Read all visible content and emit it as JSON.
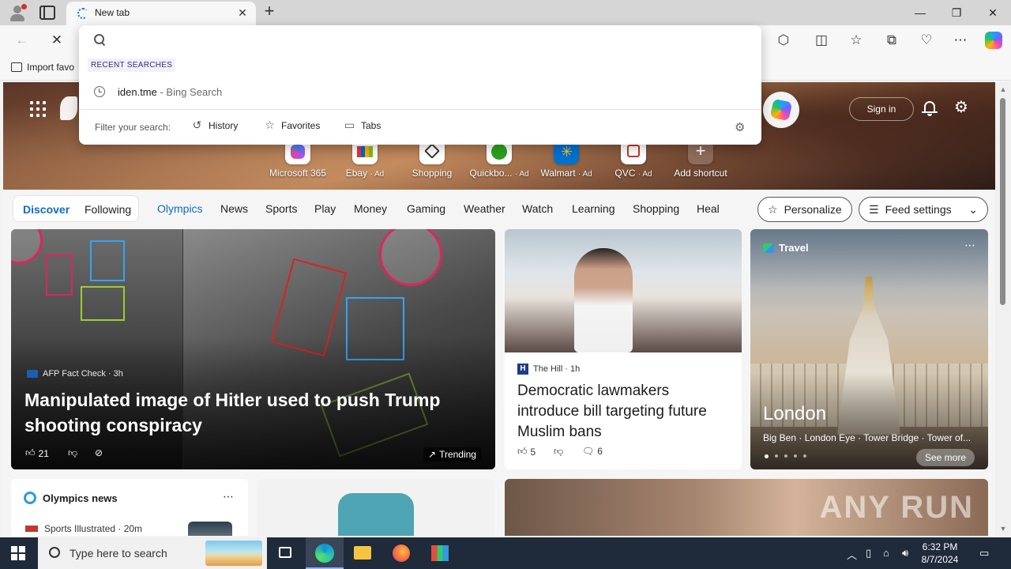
{
  "browser": {
    "tab_title": "New tab",
    "favorites_bar": {
      "import_label": "Import favo"
    }
  },
  "omnibox": {
    "placeholder": "",
    "recent_header": "RECENT SEARCHES",
    "recent": [
      {
        "query": "iden.tme",
        "suffix": " - Bing Search"
      }
    ],
    "filter_label": "Filter your search:",
    "filters": [
      "History",
      "Favorites",
      "Tabs"
    ]
  },
  "header": {
    "sign_in": "Sign in"
  },
  "shortcuts": [
    {
      "label": "Microsoft 365",
      "ad": ""
    },
    {
      "label": "Ebay",
      "ad": "· Ad"
    },
    {
      "label": "Shopping",
      "ad": ""
    },
    {
      "label": "Quickbo...",
      "ad": "· Ad"
    },
    {
      "label": "Walmart",
      "ad": "· Ad"
    },
    {
      "label": "QVC",
      "ad": "· Ad"
    },
    {
      "label": "Add shortcut",
      "ad": ""
    }
  ],
  "feed_nav": {
    "discover": "Discover",
    "following": "Following",
    "items": [
      "Olympics",
      "News",
      "Sports",
      "Play",
      "Money",
      "Gaming",
      "Weather",
      "Watch",
      "Learning",
      "Shopping",
      "Heal"
    ],
    "personalize": "Personalize",
    "feed_settings": "Feed settings"
  },
  "cards": {
    "hitler": {
      "source": "AFP Fact Check · 3h",
      "title": "Manipulated image of Hitler used to push Trump shooting conspiracy",
      "likes": "21",
      "trending": "Trending"
    },
    "hill": {
      "source": "The Hill · 1h",
      "title": "Democratic lawmakers introduce bill targeting future Muslim bans",
      "likes": "5",
      "comments": "6"
    },
    "travel": {
      "category": "Travel",
      "title": "London",
      "subtitle": "Big Ben · London Eye · Tower Bridge · Tower of...",
      "see_more": "See more"
    },
    "olympics": {
      "title": "Olympics news",
      "source": "Sports Illustrated · 20m"
    },
    "watermark": "ANY RUN"
  },
  "taskbar": {
    "search_placeholder": "Type here to search",
    "time": "6:32 PM",
    "date": "8/7/2024"
  },
  "colors": {
    "accent": "#0f6cbd",
    "taskbar": "#1f2a3a"
  }
}
